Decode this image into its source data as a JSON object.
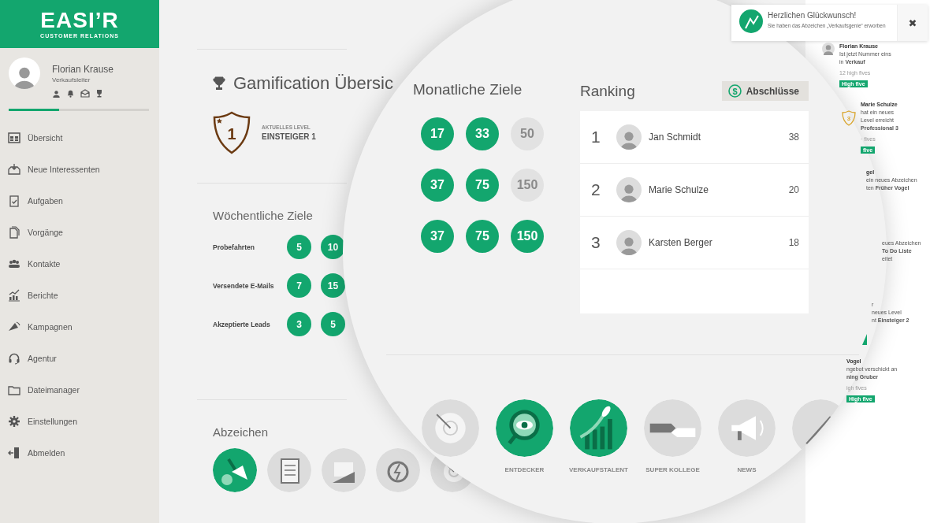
{
  "sidebar": {
    "logo": "EASI’R",
    "logo_subtitle": "CUSTOMER RELATIONS",
    "profile": {
      "name": "Florian Krause",
      "role": "Verkaufsleiter",
      "progress": {
        "level": 0.36
      }
    },
    "nav": [
      {
        "label": "Übersicht"
      },
      {
        "label": "Neue Interessenten"
      },
      {
        "label": "Aufgaben"
      },
      {
        "label": "Vorgänge"
      },
      {
        "label": "Kontakte"
      },
      {
        "label": "Berichte"
      },
      {
        "label": "Kampagnen"
      },
      {
        "label": "Agentur"
      },
      {
        "label": "Dateimanager"
      },
      {
        "label": "Einstellungen"
      },
      {
        "label": "Abmelden"
      }
    ]
  },
  "toast": {
    "title": "Herzlichen Glückwunsch!",
    "message": "Sie haben das Abzeichen „Verkaufsgenie“ erworben",
    "close": "✖"
  },
  "overview": {
    "title": "Gamification Übersic",
    "level_number": "1",
    "level_caption": "AKTUELLES LEVEL",
    "level_name": "EINSTEIGER 1"
  },
  "weekly_goals": {
    "title": "Wöchentliche Ziele",
    "rows": [
      {
        "label": "Probefahrten",
        "goals": [
          {
            "value": "5",
            "achieved": true
          },
          {
            "value": "10",
            "achieved": true
          }
        ]
      },
      {
        "label": "Versendete E-Mails",
        "goals": [
          {
            "value": "7",
            "achieved": true
          },
          {
            "value": "15",
            "achieved": true
          }
        ]
      },
      {
        "label": "Akzeptierte Leads",
        "goals": [
          {
            "value": "3",
            "achieved": true
          },
          {
            "value": "5",
            "achieved": true
          }
        ]
      }
    ]
  },
  "badges": {
    "title": "Abzeichen",
    "items": [
      {
        "earned": true
      },
      {
        "earned": false
      },
      {
        "earned": false
      },
      {
        "earned": false
      },
      {
        "earned": false
      }
    ]
  },
  "monthly_goals": {
    "title": "Monatliche Ziele",
    "rows": [
      [
        {
          "value": "17",
          "achieved": true
        },
        {
          "value": "33",
          "achieved": true
        },
        {
          "value": "50",
          "achieved": false
        }
      ],
      [
        {
          "value": "37",
          "achieved": true
        },
        {
          "value": "75",
          "achieved": true
        },
        {
          "value": "150",
          "achieved": false
        }
      ],
      [
        {
          "value": "37",
          "achieved": true
        },
        {
          "value": "75",
          "achieved": true
        },
        {
          "value": "150",
          "achieved": true
        }
      ]
    ]
  },
  "ranking": {
    "title": "Ranking",
    "filter": "Abschlüsse",
    "filter_symbol": "$",
    "rows": [
      {
        "rank": "1",
        "name": "Jan Schmidt",
        "score": "38"
      },
      {
        "rank": "2",
        "name": "Marie Schulze",
        "score": "20"
      },
      {
        "rank": "3",
        "name": "Karsten Berger",
        "score": "18"
      }
    ]
  },
  "featured_badges": [
    {
      "earned": false
    },
    {
      "label": "ENTDECKER",
      "earned": true
    },
    {
      "label": "VERKAUFSTALENT",
      "earned": true
    },
    {
      "label": "SUPER KOLLEGE",
      "earned": false
    },
    {
      "label": "NEWS",
      "earned": false
    },
    {
      "earned": false
    }
  ],
  "feed": [
    {
      "kind": "person",
      "name": "Florian Krause",
      "lines": [
        "Ist jetzt Nummer eins",
        "in **Verkauf**"
      ],
      "meta": "12 high fives",
      "button": "High five"
    },
    {
      "kind": "level",
      "name": "Marie Schulze",
      "level": "3",
      "lines": [
        "hat ein neues",
        "Level erreicht",
        "**Professional 3**"
      ],
      "meta": "· fives",
      "button": "five"
    },
    {
      "kind": "plain",
      "name": "gel",
      "lines": [
        "ein neues Abzeichen",
        "ten **Früher Vogel**"
      ]
    },
    {
      "kind": "plain",
      "lines": [
        "eues Abzeichen",
        "**To Do Liste**",
        "eitet"
      ]
    },
    {
      "kind": "badge",
      "lines": [
        "r",
        "neues Level",
        "nt **Einsteiger 2**"
      ]
    },
    {
      "kind": "plain",
      "name": "Vogel",
      "lines": [
        "ngebot verschickt an",
        "**ning Gruber**"
      ],
      "meta": "igh fives",
      "button": "High five"
    }
  ]
}
